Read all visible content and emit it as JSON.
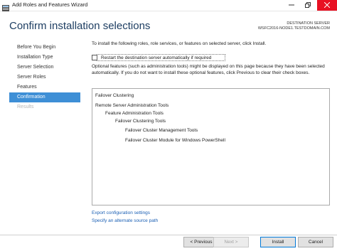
{
  "window": {
    "title": "Add Roles and Features Wizard"
  },
  "header": {
    "page_title": "Confirm installation selections",
    "destination_label": "DESTINATION SERVER",
    "destination_server": "WSFC2016-NODE1.TESTDOMAIN.COM"
  },
  "nav": {
    "items": [
      {
        "label": "Before You Begin",
        "state": "normal"
      },
      {
        "label": "Installation Type",
        "state": "normal"
      },
      {
        "label": "Server Selection",
        "state": "normal"
      },
      {
        "label": "Server Roles",
        "state": "normal"
      },
      {
        "label": "Features",
        "state": "normal"
      },
      {
        "label": "Confirmation",
        "state": "active"
      },
      {
        "label": "Results",
        "state": "disabled"
      }
    ]
  },
  "main": {
    "intro": "To install the following roles, role services, or features on selected server, click Install.",
    "restart_checkbox": {
      "label": "Restart the destination server automatically if required",
      "checked": false
    },
    "optional_note": "Optional features (such as administration tools) might be displayed on this page because they have been selected automatically. If you do not want to install these optional features, click Previous to clear their check boxes.",
    "features": [
      {
        "label": "Failover Clustering",
        "level": 0
      },
      {
        "label": "Remote Server Administration Tools",
        "level": 0
      },
      {
        "label": "Feature Administration Tools",
        "level": 1
      },
      {
        "label": "Failover Clustering Tools",
        "level": 2
      },
      {
        "label": "Failover Cluster Management Tools",
        "level": 3
      },
      {
        "label": "Failover Cluster Module for Windows PowerShell",
        "level": 3
      }
    ],
    "links": {
      "export": "Export configuration settings",
      "alternate_source": "Specify an alternate source path"
    }
  },
  "footer": {
    "previous": "< Previous",
    "next": "Next >",
    "install": "Install",
    "cancel": "Cancel"
  },
  "icons": {
    "app": "server-manager-icon",
    "minimize": "minimize-icon",
    "maximize": "restore-icon",
    "close": "close-icon"
  },
  "colors": {
    "accent": "#3e8fd6",
    "title": "#1e3e62",
    "link": "#1a5fb4",
    "close_button": "#e81123"
  }
}
